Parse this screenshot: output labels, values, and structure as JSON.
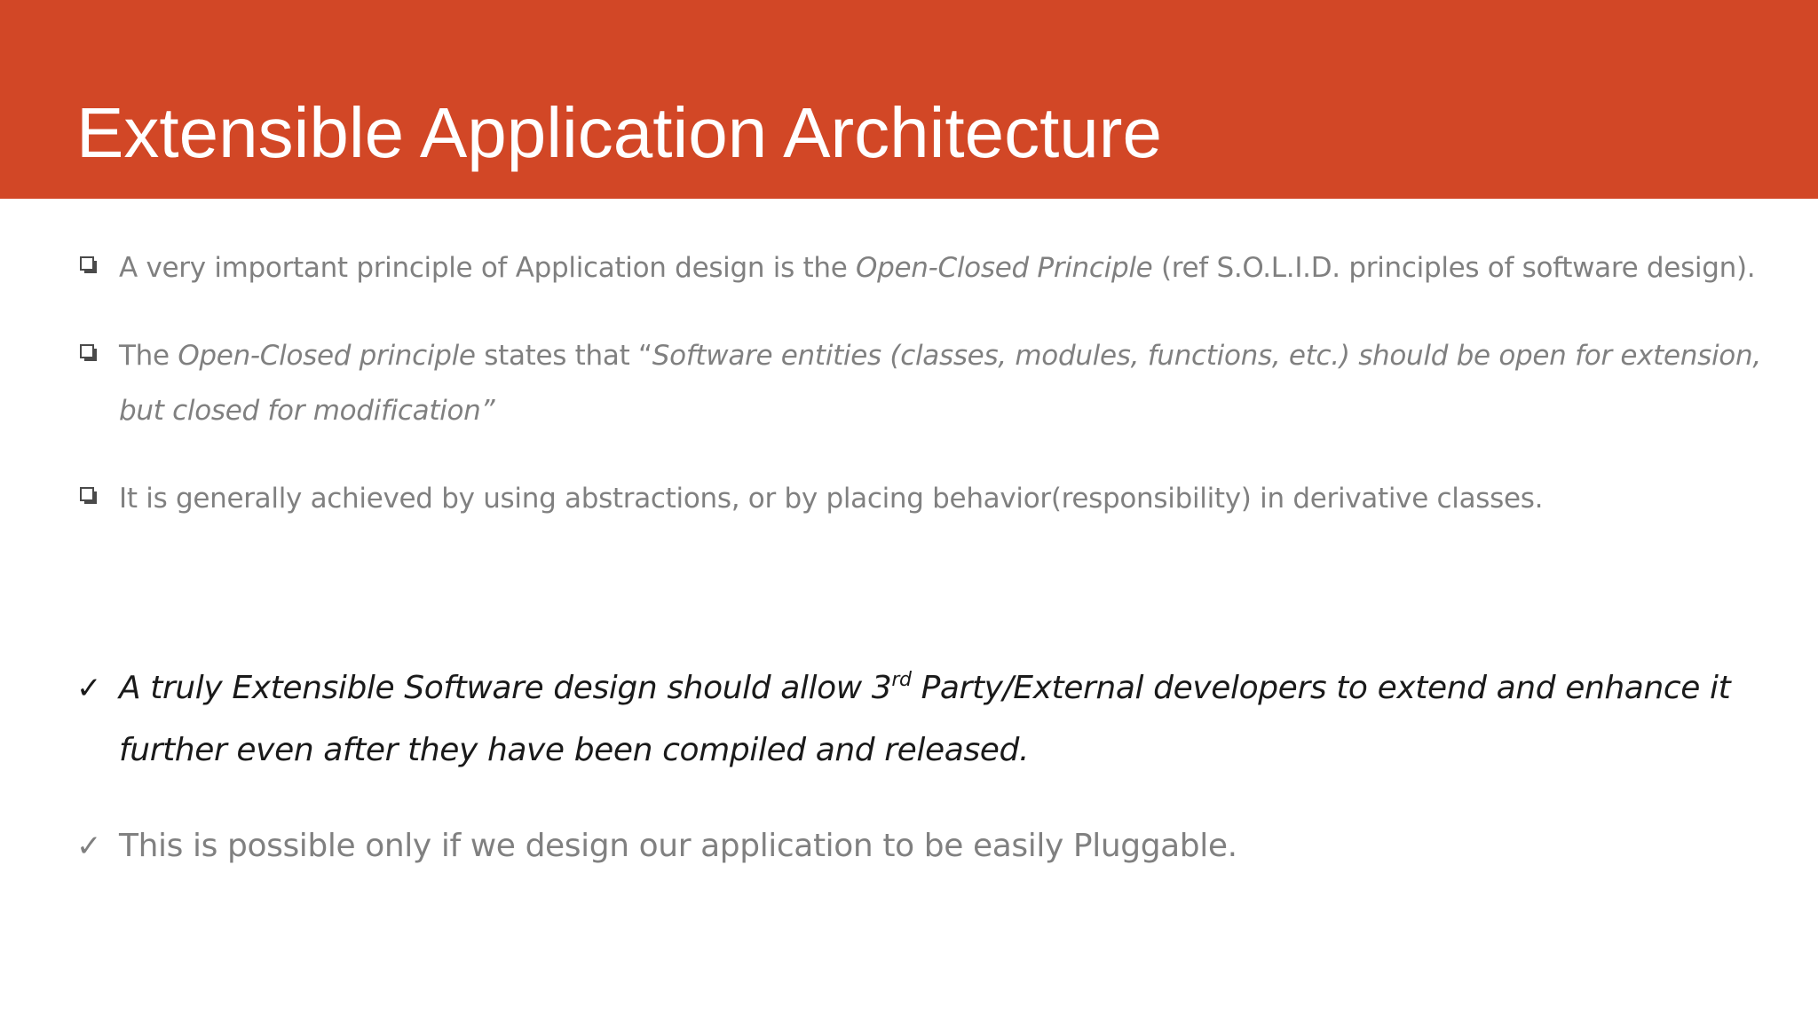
{
  "slide": {
    "title": "Extensible Application Architecture",
    "colors": {
      "header_bg": "#d24726",
      "title_text": "#ffffff",
      "body_gray": "#808080",
      "body_dark": "#1a1a1a"
    },
    "bullets": [
      {
        "marker": "checkbox-icon",
        "parts": [
          {
            "text": "A very important principle of Application design is the ",
            "italic": false
          },
          {
            "text": "Open-Closed Principle",
            "italic": true
          },
          {
            "text": " (ref S.O.L.I.D. principles of software design).",
            "italic": false
          }
        ]
      },
      {
        "marker": "checkbox-icon",
        "parts": [
          {
            "text": "The ",
            "italic": false
          },
          {
            "text": "Open-Closed principle",
            "italic": true
          },
          {
            "text": " states that “",
            "italic": false
          },
          {
            "text": "Software entities (classes, modules, functions, etc.) should be open for extension, but closed for modification”",
            "italic": true
          }
        ]
      },
      {
        "marker": "checkbox-icon",
        "parts": [
          {
            "text": "It is generally achieved by using abstractions, or by placing behavior(responsibility) in derivative classes.",
            "italic": false
          }
        ]
      },
      {
        "marker": "checkmark-icon",
        "check": "✓",
        "parts": [
          {
            "text": "A truly Extensible Software design should allow 3",
            "italic": true
          },
          {
            "text": "rd",
            "italic": true,
            "sup": true
          },
          {
            "text": " Party/External developers to extend and enhance it further even after they have been compiled and released.",
            "italic": true
          }
        ]
      },
      {
        "marker": "checkmark-icon",
        "check": "✓",
        "parts": [
          {
            "text": "This is possible only if we design our application to be easily Pluggable.",
            "italic": false
          }
        ]
      }
    ]
  }
}
